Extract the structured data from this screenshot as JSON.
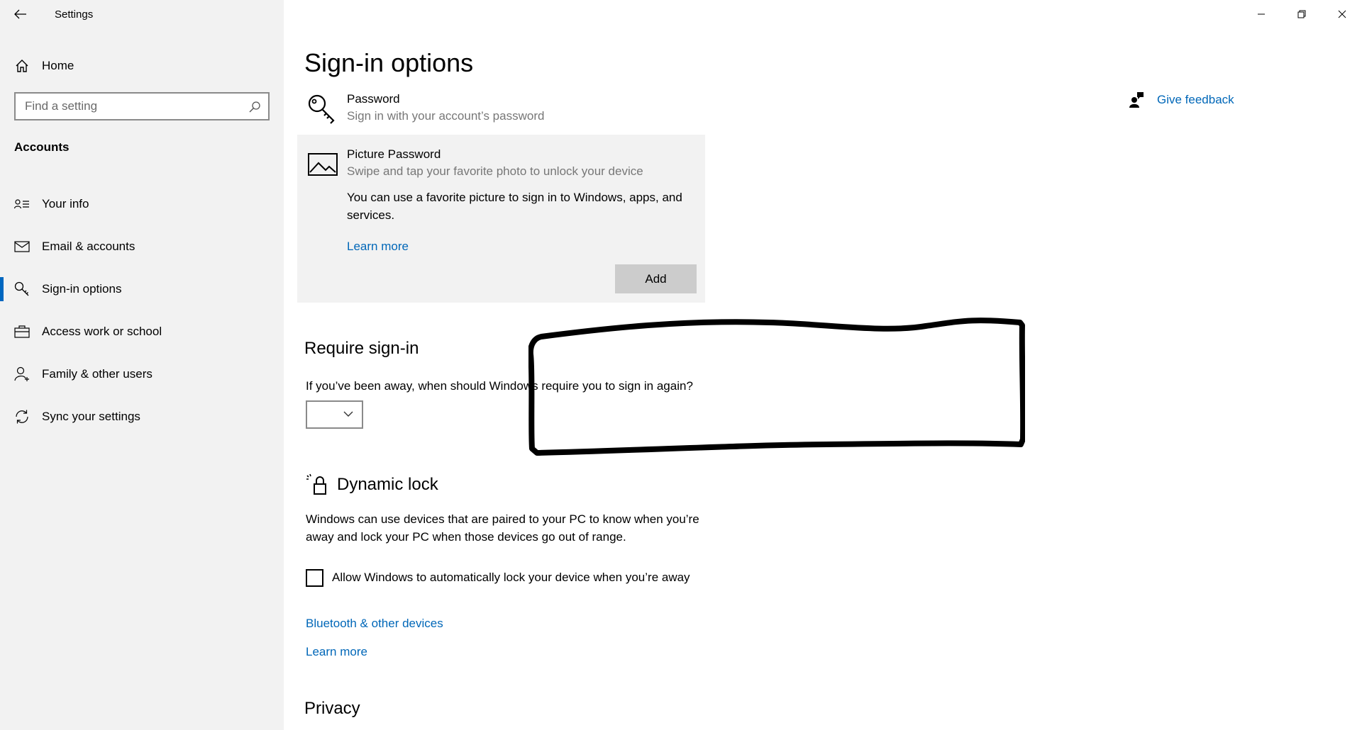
{
  "window": {
    "title": "Settings",
    "controls": [
      "minimize-icon",
      "restore-icon",
      "close-icon"
    ]
  },
  "sidebar": {
    "home_label": "Home",
    "search_placeholder": "Find a setting",
    "section_heading": "Accounts",
    "active_item": "Sign-in options",
    "accent_color": "#0067c0",
    "items": [
      {
        "label": "Your info",
        "icon": "person-list-icon"
      },
      {
        "label": "Email & accounts",
        "icon": "mail-icon"
      },
      {
        "label": "Sign-in options",
        "icon": "key-icon"
      },
      {
        "label": "Access work or school",
        "icon": "briefcase-icon"
      },
      {
        "label": "Family & other users",
        "icon": "person-add-icon"
      },
      {
        "label": "Sync your settings",
        "icon": "sync-icon"
      }
    ]
  },
  "main": {
    "page_title": "Sign-in options",
    "feedback_label": "Give feedback",
    "password": {
      "title": "Password",
      "subtitle": "Sign in with your account’s password"
    },
    "picture_password": {
      "title": "Picture Password",
      "subtitle": "Swipe and tap your favorite photo to unlock your device",
      "description": "You can use a favorite picture to sign in to Windows, apps, and services.",
      "learn_more": "Learn more",
      "add_button": "Add"
    },
    "require_signin": {
      "heading": "Require sign-in",
      "question": "If you’ve been away, when should Windows require you to sign in again?",
      "selected_value": ""
    },
    "dynamic_lock": {
      "heading": "Dynamic lock",
      "description": "Windows can use devices that are paired to your PC to know when you’re away and lock your PC when those devices go out of range.",
      "checkbox_label": "Allow Windows to automatically lock your device when you’re away",
      "checked": false,
      "bluetooth_link": "Bluetooth & other devices",
      "learn_more": "Learn more"
    },
    "privacy_heading": "Privacy",
    "link_color": "#0067b8"
  }
}
